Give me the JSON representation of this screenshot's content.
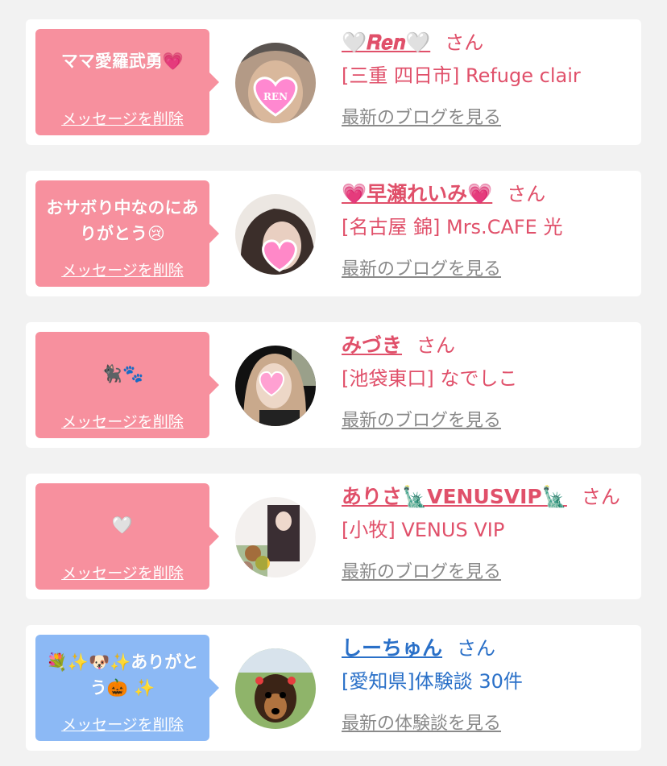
{
  "delete_label": "メッセージを削除",
  "honorific": "さん",
  "colors": {
    "pink_bubble": "#f7909e",
    "blue_bubble": "#8cb9f5",
    "pink_text": "#e0506a",
    "blue_text": "#2a70c8",
    "muted": "#8a8a8a"
  },
  "entries": [
    {
      "message": "ママ愛羅武勇💗",
      "name": "🤍𝑹𝒆𝒏🤍",
      "shop": "[三重 四日市] Refuge clair",
      "link": "最新のブログを見る",
      "avatar_icon": "girl-heart-sticker"
    },
    {
      "message": "おサボり中なのにありがとう😢",
      "name": "💗早瀬れいみ💗",
      "shop": "[名古屋 錦] Mrs.CAFE 光",
      "link": "最新のブログを見る",
      "avatar_icon": "girl-heart-sticker"
    },
    {
      "message": "🐈‍⬛🐾",
      "name": "みづき",
      "shop": "[池袋東口] なでしこ",
      "link": "最新のブログを見る",
      "avatar_icon": "girl-heart-sticker"
    },
    {
      "message": "🤍",
      "name": "ありさ🗽VENUSVIP🗽",
      "shop": "[小牧] VENUS VIP",
      "link": "最新のブログを見る",
      "avatar_icon": "girl-flowers"
    },
    {
      "message": "💐✨🐶✨ありがとう🎃 ✨",
      "name": "しーちゅん",
      "shop": "[愛知県]体験談 30件",
      "link": "最新の体験談を見る",
      "avatar_icon": "dog-photo"
    }
  ]
}
